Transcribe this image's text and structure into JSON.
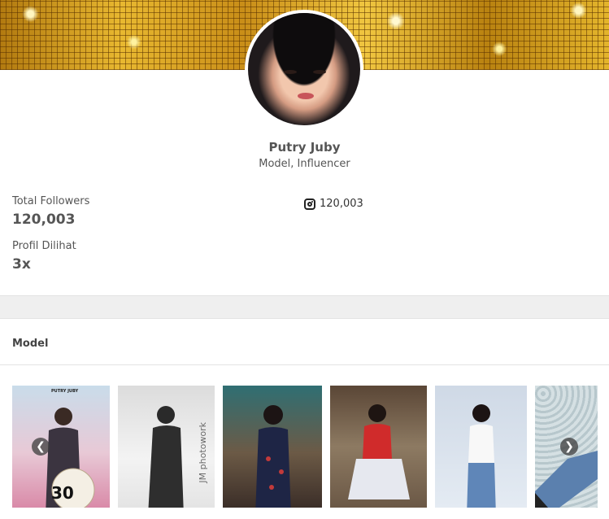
{
  "profile": {
    "name": "Putry Juby",
    "role": "Model, Influencer"
  },
  "stats": {
    "followers_label": "Total Followers",
    "followers_value": "120,003",
    "views_label": "Profil Dilihat",
    "views_value": "3x"
  },
  "social": {
    "instagram_icon": "instagram-icon",
    "instagram_count": "120,003"
  },
  "section": {
    "title": "Model"
  },
  "gallery": {
    "photos": [
      {
        "caption": "PUTRY JUBY",
        "overlay": "30"
      },
      {
        "caption": "",
        "overlay": "JM photowork"
      },
      {
        "caption": "",
        "overlay": ""
      },
      {
        "caption": "",
        "overlay": ""
      },
      {
        "caption": "",
        "overlay": ""
      },
      {
        "caption": "",
        "overlay": ""
      }
    ],
    "prev_icon": "arrow-left-icon",
    "next_icon": "arrow-right-icon"
  },
  "colors": {
    "cover_gold": "#e8b830",
    "text_muted": "#555555",
    "band": "#efefef"
  }
}
